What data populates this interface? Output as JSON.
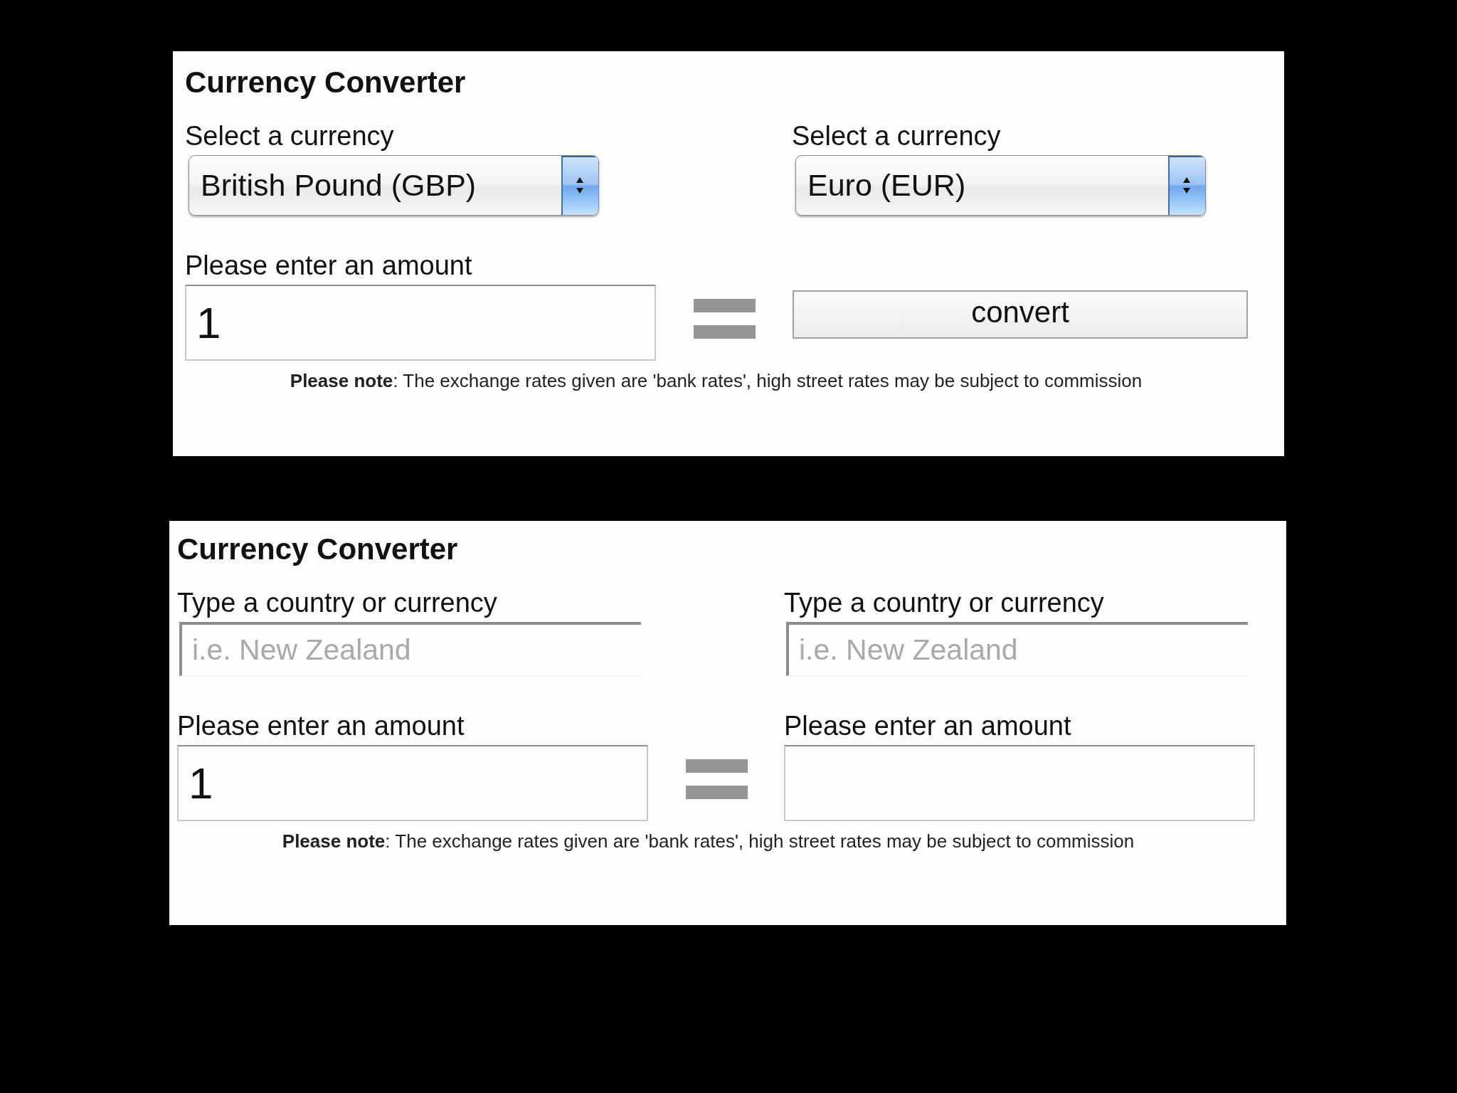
{
  "converters": [
    {
      "title": "Currency Converter",
      "currency_fields": [
        {
          "kind": "select",
          "label": "Select a currency",
          "value": "British Pound (GBP)"
        },
        {
          "kind": "select",
          "label": "Select a currency",
          "value": "Euro (EUR)"
        }
      ],
      "amount": {
        "label": "Please enter an amount",
        "value": "1"
      },
      "result": {
        "kind": "button",
        "label": "convert"
      },
      "note": "**Please note**: The exchange rates given are 'bank rates', high street rates may be subject to commission"
    },
    {
      "title": "Currency Converter",
      "currency_fields": [
        {
          "kind": "search",
          "label": "Type a country or currency",
          "placeholder": "i.e. New Zealand"
        },
        {
          "kind": "search",
          "label": "Type a country or currency",
          "placeholder": "i.e. New Zealand"
        }
      ],
      "amount": {
        "label": "Please enter an amount",
        "value": "1"
      },
      "result": {
        "kind": "amount_field",
        "label": "Please enter an amount"
      },
      "note": "**Please note**: The exchange rates given are 'bank rates', high street rates may be subject to commission"
    }
  ]
}
